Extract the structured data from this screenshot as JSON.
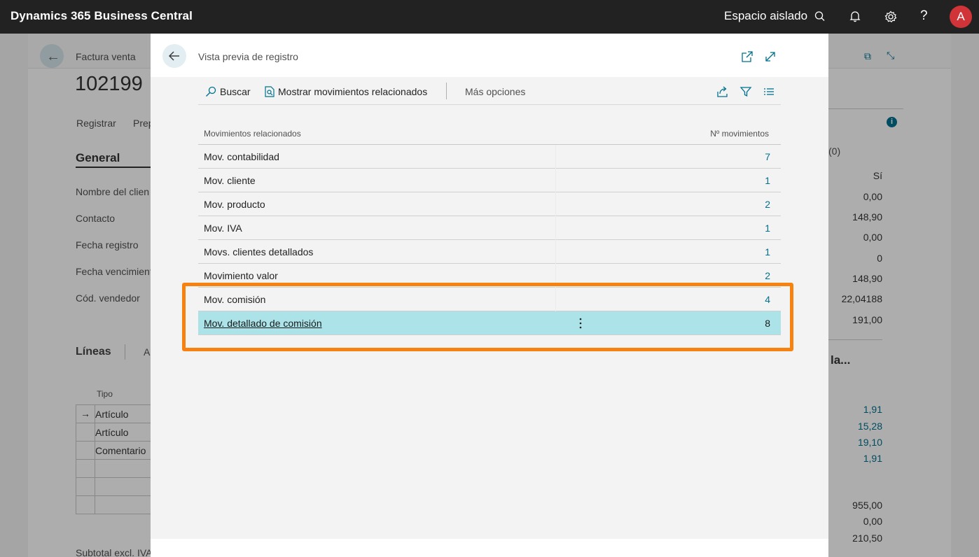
{
  "topbar": {
    "brand": "Dynamics 365 Business Central",
    "environment": "Espacio aislado",
    "avatar_initial": "A",
    "icons": [
      "search-icon",
      "bell-icon",
      "gear-icon",
      "help-icon"
    ]
  },
  "background_page": {
    "breadcrumb": "Factura venta",
    "doc_number": "102199 ·",
    "header_right_text": "do",
    "actions": [
      "Registrar",
      "Prep"
    ],
    "section_general": "General",
    "fields": [
      "Nombre del clien",
      "Contacto",
      "Fecha registro",
      "Fecha vencimient",
      "Cód. vendedor"
    ],
    "lines_tab": "Líneas",
    "lines_tab2": "A",
    "grid_header_tipo": "Tipo",
    "grid_rows": [
      "Artículo",
      "Artículo",
      "Comentario",
      "",
      "",
      ""
    ],
    "subtotal_label": "Subtotal excl. IVA",
    "factbox_count": "(0)",
    "factbox_si": "Sí",
    "factbox_values": [
      "0,00",
      "148,90",
      "0,00",
      "0",
      "148,90",
      "22,04188",
      "191,00"
    ],
    "factbox_section2": "la...",
    "factbox_links": [
      "1,91",
      "15,28",
      "19,10",
      "1,91"
    ],
    "factbox_totals": [
      "955,00",
      "0,00",
      "210,50"
    ]
  },
  "modal": {
    "title": "Vista previa de registro",
    "actions": {
      "search": "Buscar",
      "show_related": "Mostrar movimientos relacionados",
      "more": "Más opciones"
    },
    "columns": {
      "name": "Movimientos relacionados",
      "count": "Nº movimientos"
    },
    "rows": [
      {
        "name": "Mov. contabilidad",
        "count": "7"
      },
      {
        "name": "Mov. cliente",
        "count": "1"
      },
      {
        "name": "Mov. producto",
        "count": "2"
      },
      {
        "name": "Mov. IVA",
        "count": "1"
      },
      {
        "name": "Movs. clientes detallados",
        "count": "1"
      },
      {
        "name": "Movimiento valor",
        "count": "2"
      },
      {
        "name": "Mov. comisión",
        "count": "4"
      },
      {
        "name": "Mov. detallado de comisión",
        "count": "8"
      }
    ],
    "selected_row_index": 7
  },
  "colors": {
    "topbar": "#222222",
    "accent_link": "#00718f",
    "selected_row": "#abe3e8",
    "highlight_box": "#f7820f",
    "avatar": "#d13438"
  }
}
